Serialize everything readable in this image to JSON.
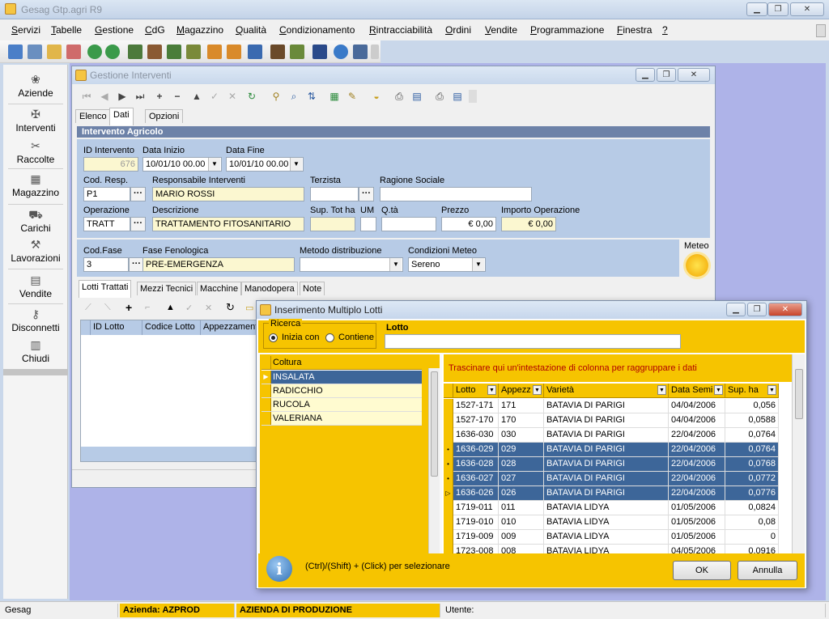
{
  "app": {
    "title": "Gesag Gtp.agri R9"
  },
  "menu": [
    "Servizi",
    "Tabelle",
    "Gestione",
    "CdG",
    "Magazzino",
    "Qualità",
    "Condizionamento",
    "Rintracciabilità",
    "Ordini",
    "Vendite",
    "Programmazione",
    "Finestra",
    "?"
  ],
  "sidebar": {
    "items": [
      {
        "label": "Aziende",
        "icon": "leaf-icon"
      },
      {
        "label": "Interventi",
        "icon": "tractor-icon"
      },
      {
        "label": "Raccolte",
        "icon": "harvest-icon"
      },
      {
        "label": "Magazzino",
        "icon": "warehouse-icon"
      },
      {
        "label": "Carichi",
        "icon": "truck-icon"
      },
      {
        "label": "Lavorazioni",
        "icon": "tools-icon"
      },
      {
        "label": "Vendite",
        "icon": "cash-register-icon"
      },
      {
        "label": "Disconnetti",
        "icon": "key-icon"
      },
      {
        "label": "Chiudi",
        "icon": "door-icon"
      }
    ]
  },
  "gi": {
    "title": "Gestione Interventi",
    "tabs": [
      "Elenco",
      "Dati",
      "Opzioni"
    ],
    "section": "Intervento Agricolo",
    "labels": {
      "id_intervento": "ID Intervento",
      "data_inizio": "Data Inizio",
      "data_fine": "Data Fine",
      "cod_resp": "Cod. Resp.",
      "responsabile": "Responsabile Interventi",
      "terzista": "Terzista",
      "ragione_sociale": "Ragione Sociale",
      "operazione": "Operazione",
      "descrizione": "Descrizione",
      "sup_tot": "Sup. Tot ha",
      "um": "UM",
      "qta": "Q.tà",
      "prezzo": "Prezzo",
      "importo": "Importo Operazione",
      "cod_fase": "Cod.Fase",
      "fase": "Fase Fenologica",
      "metodo": "Metodo distribuzione",
      "condizioni": "Condizioni Meteo",
      "meteo": "Meteo"
    },
    "values": {
      "id_intervento": "676",
      "data_inizio": "10/01/10 00.00",
      "data_fine": "10/01/10 00.00",
      "cod_resp": "P1",
      "responsabile": "MARIO ROSSI",
      "terzista": "",
      "ragione_sociale": "",
      "operazione": "TRATT",
      "descrizione": "TRATTAMENTO FITOSANITARIO",
      "sup_tot": "",
      "um": "",
      "qta": "",
      "prezzo": "€ 0,00",
      "importo": "€ 0,00",
      "cod_fase": "3",
      "fase": "PRE-EMERGENZA",
      "metodo": "",
      "condizioni": "Sereno"
    },
    "subtabs": [
      "Lotti Trattati",
      "Mezzi Tecnici",
      "Macchine",
      "Manodopera",
      "Note"
    ],
    "subgrid_headers": [
      "ID Lotto",
      "Codice Lotto",
      "Appezzamento"
    ]
  },
  "modal": {
    "title": "Inserimento Multiplo Lotti",
    "ricerca": "Ricerca",
    "opt_inizia": "Inizia con",
    "opt_contiene": "Contiene",
    "lotto_label": "Lotto",
    "lotto_value": "",
    "coltura_header": "Coltura",
    "colture": [
      "INSALATA",
      "RADICCHIO",
      "RUCOLA",
      "VALERIANA"
    ],
    "group_hint": "Trascinare qui un'intestazione di colonna per raggruppare i dati",
    "columns": [
      "Lotto",
      "Appezz",
      "Varietà",
      "Data Semi",
      "Sup. ha"
    ],
    "rows": [
      {
        "lotto": "1527-171",
        "app": "171",
        "var": "BATAVIA DI PARIGI",
        "data": "04/04/2006",
        "sup": "0,056",
        "sel": false,
        "ind": ""
      },
      {
        "lotto": "1527-170",
        "app": "170",
        "var": "BATAVIA DI PARIGI",
        "data": "04/04/2006",
        "sup": "0,0588",
        "sel": false,
        "ind": ""
      },
      {
        "lotto": "1636-030",
        "app": "030",
        "var": "BATAVIA DI PARIGI",
        "data": "22/04/2006",
        "sup": "0,0764",
        "sel": false,
        "ind": ""
      },
      {
        "lotto": "1636-029",
        "app": "029",
        "var": "BATAVIA DI PARIGI",
        "data": "22/04/2006",
        "sup": "0,0764",
        "sel": true,
        "ind": "•"
      },
      {
        "lotto": "1636-028",
        "app": "028",
        "var": "BATAVIA DI PARIGI",
        "data": "22/04/2006",
        "sup": "0,0768",
        "sel": true,
        "ind": "•"
      },
      {
        "lotto": "1636-027",
        "app": "027",
        "var": "BATAVIA DI PARIGI",
        "data": "22/04/2006",
        "sup": "0,0772",
        "sel": true,
        "ind": "•"
      },
      {
        "lotto": "1636-026",
        "app": "026",
        "var": "BATAVIA DI PARIGI",
        "data": "22/04/2006",
        "sup": "0,0776",
        "sel": true,
        "ind": "▷"
      },
      {
        "lotto": "1719-011",
        "app": "011",
        "var": "BATAVIA LIDYA",
        "data": "01/05/2006",
        "sup": "0,0824",
        "sel": false,
        "ind": ""
      },
      {
        "lotto": "1719-010",
        "app": "010",
        "var": "BATAVIA LIDYA",
        "data": "01/05/2006",
        "sup": "0,08",
        "sel": false,
        "ind": ""
      },
      {
        "lotto": "1719-009",
        "app": "009",
        "var": "BATAVIA LIDYA",
        "data": "01/05/2006",
        "sup": "0",
        "sel": false,
        "ind": ""
      },
      {
        "lotto": "1723-008",
        "app": "008",
        "var": "BATAVIA LIDYA",
        "data": "04/05/2006",
        "sup": "0,0916",
        "sel": false,
        "ind": ""
      }
    ],
    "hint": "(Ctrl)/(Shift) + (Click) per selezionare",
    "ok": "OK",
    "annulla": "Annulla"
  },
  "status": {
    "app": "Gesag",
    "azienda": "Azienda: AZPROD",
    "azienda_nome": "AZIENDA DI PRODUZIONE",
    "utente": "Utente:"
  }
}
